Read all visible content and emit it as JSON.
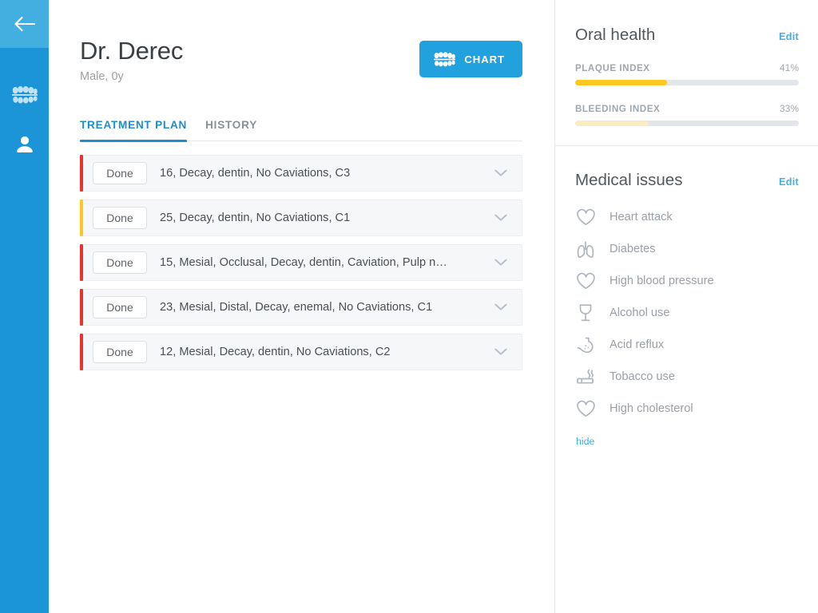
{
  "sidebar": {
    "back_icon": "arrow-left-icon",
    "items": [
      {
        "icon": "teeth-icon",
        "name": "sidebar-item-chart"
      },
      {
        "icon": "person-icon",
        "name": "sidebar-item-patient"
      }
    ]
  },
  "header": {
    "patient_name": "Dr. Derec",
    "patient_meta": "Male, 0y",
    "chart_button_label": "CHART",
    "chart_button_icon": "teeth-icon",
    "chart_button_color": "#21A2DE"
  },
  "tabs": [
    {
      "label": "TREATMENT PLAN",
      "active": true
    },
    {
      "label": "HISTORY",
      "active": false
    }
  ],
  "treatment_plan": {
    "rows": [
      {
        "status": "Done",
        "text": "16, Decay, dentin, No Caviations, C3",
        "accent": "#E8342A",
        "chevron": "chevron-down-icon"
      },
      {
        "status": "Done",
        "text": "25, Decay, dentin, No Caviations, C1",
        "accent": "#FFC820",
        "chevron": "chevron-down-icon"
      },
      {
        "status": "Done",
        "text": "15, Mesial, Occlusal, Decay, dentin, Caviation, Pulp n…",
        "accent": "#E8342A",
        "chevron": "chevron-down-icon"
      },
      {
        "status": "Done",
        "text": "23, Mesial, Distal, Decay, enemal, No Caviations, C1",
        "accent": "#E8342A",
        "chevron": "chevron-down-icon"
      },
      {
        "status": "Done",
        "text": "12, Mesial, Decay, dentin, No Caviations, C2",
        "accent": "#E8342A",
        "chevron": "chevron-down-icon"
      }
    ]
  },
  "oral_health": {
    "title": "Oral health",
    "edit_label": "Edit",
    "metrics": [
      {
        "label": "PLAQUE INDEX",
        "value": "41%",
        "percent": 41,
        "color": "#FFC820"
      },
      {
        "label": "BLEEDING INDEX",
        "value": "33%",
        "percent": 33,
        "color": "#FAECC0"
      }
    ]
  },
  "medical_issues": {
    "title": "Medical issues",
    "edit_label": "Edit",
    "hide_label": "hide",
    "items": [
      {
        "label": "Heart attack",
        "icon": "heart-icon"
      },
      {
        "label": "Diabetes",
        "icon": "lungs-icon"
      },
      {
        "label": "High blood pressure",
        "icon": "heart-icon"
      },
      {
        "label": "Alcohol use",
        "icon": "wine-glass-icon"
      },
      {
        "label": "Acid reflux",
        "icon": "stomach-icon"
      },
      {
        "label": "Tobacco use",
        "icon": "cigarette-icon"
      },
      {
        "label": "High cholesterol",
        "icon": "heart-icon"
      }
    ]
  }
}
